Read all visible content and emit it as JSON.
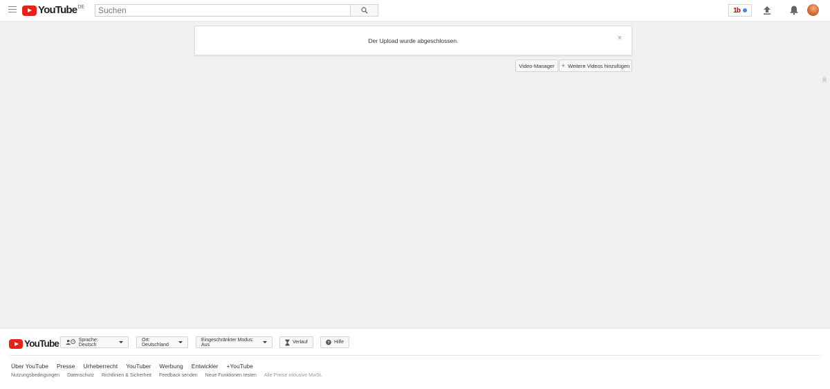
{
  "header": {
    "logo_text": "YouTube",
    "country_code": "DE",
    "search": {
      "placeholder": "Suchen",
      "value": ""
    },
    "promo_badge": "1b"
  },
  "notification": {
    "message": "Der Upload wurde abgeschlossen.",
    "close_label": "×"
  },
  "actions": {
    "video_manager": "Video-Manager",
    "add_more_plus": "+",
    "add_more": "Weitere Videos hinzufügen"
  },
  "footer": {
    "logo_text": "YouTube",
    "language": "Sprache: Deutsch",
    "location": "Ort: Deutschland",
    "restricted_mode": "Eingeschränkter Modus: Aus",
    "history": "Verlauf",
    "help": "Hilfe",
    "primary_links": [
      "Über YouTube",
      "Presse",
      "Urheberrecht",
      "YouTuber",
      "Werbung",
      "Entwickler",
      "+YouTube"
    ],
    "secondary_links": [
      "Nutzungsbedingungen",
      "Datenschutz",
      "Richtlinien & Sicherheit",
      "Feedback senden",
      "Neue Funktionen testen"
    ],
    "price_note": "Alle Preise inklusive MwSt."
  },
  "colors": {
    "brand_red": "#e62117",
    "notification_dot": "#3e8ce5",
    "page_background": "#f1f1f1"
  },
  "icons": [
    "menu-icon",
    "search-icon",
    "upload-icon",
    "bell-icon",
    "close-icon",
    "plus-icon",
    "language-icon",
    "caret-down-icon",
    "hourglass-icon",
    "help-icon"
  ]
}
